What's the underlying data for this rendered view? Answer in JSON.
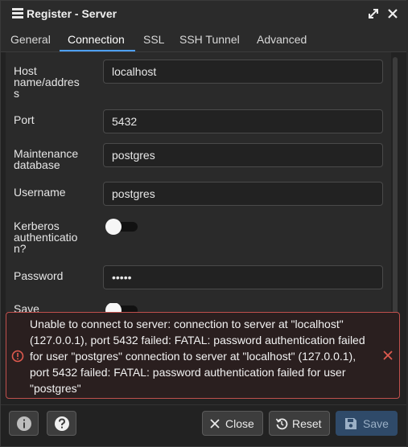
{
  "window": {
    "title": "Register - Server",
    "icons": {
      "app": "server-icon",
      "maximize": "expand-icon",
      "close": "close-icon"
    }
  },
  "tabs": [
    {
      "label": "General"
    },
    {
      "label": "Connection",
      "active": true
    },
    {
      "label": "SSL"
    },
    {
      "label": "SSH Tunnel"
    },
    {
      "label": "Advanced"
    }
  ],
  "form": {
    "host": {
      "label_line1": "Host",
      "label_line2": "name/addres",
      "label_line3": "s",
      "value": "localhost"
    },
    "port": {
      "label": "Port",
      "value": "5432"
    },
    "maintenance_db": {
      "label_line1": "Maintenance",
      "label_line2": "database",
      "value": "postgres"
    },
    "username": {
      "label": "Username",
      "value": "postgres"
    },
    "kerberos": {
      "label_line1": "Kerberos",
      "label_line2": "authenticatio",
      "label_line3": "n?",
      "enabled": false
    },
    "password": {
      "label": "Password",
      "value": "•••••"
    },
    "save_password": {
      "label": "Save",
      "enabled": false
    }
  },
  "error": {
    "lines": [
      "Unable to connect to server: connection to server at \"localhost\"",
      "(127.0.0.1), port 5432 failed: FATAL: password authentication failed",
      "for user \"postgres\" connection to server at \"localhost\" (127.0.0.1),",
      "port 5432 failed: FATAL: password authentication failed for user",
      "\"postgres\""
    ],
    "icon": "alert-circle-icon",
    "color": "#c0504d"
  },
  "footer": {
    "info_icon": "info-icon",
    "help_icon": "help-icon",
    "close_label": "Close",
    "reset_label": "Reset",
    "save_label": "Save"
  },
  "colors": {
    "accent": "#4ea0ff",
    "error": "#e05a4f",
    "save_bg": "#2f4a69"
  }
}
